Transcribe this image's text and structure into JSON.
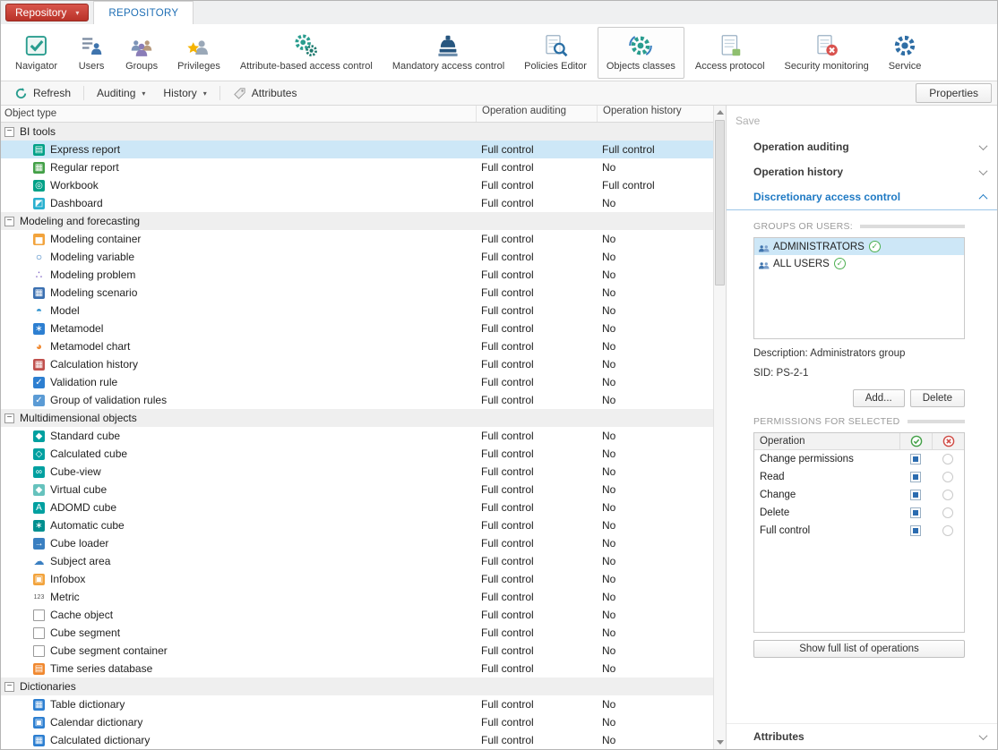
{
  "app": {
    "repository_button": "Repository",
    "tab": "REPOSITORY"
  },
  "colors": {
    "accent_blue": "#1f7ac4",
    "selection_blue": "#cde7f7",
    "repository_red": "#b93228",
    "check_green": "#43a047",
    "deny_red": "#cf4a44",
    "checkbox_blue": "#2b6cb0"
  },
  "ribbon": {
    "items": [
      {
        "label": "Navigator",
        "icon": "navigator-icon"
      },
      {
        "label": "Users",
        "icon": "users-icon"
      },
      {
        "label": "Groups",
        "icon": "groups-icon"
      },
      {
        "label": "Privileges",
        "icon": "privileges-icon"
      },
      {
        "label": "Attribute-based access control",
        "icon": "attribute-access-icon"
      },
      {
        "label": "Mandatory access control",
        "icon": "mandatory-access-icon"
      },
      {
        "label": "Policies Editor",
        "icon": "policies-editor-icon"
      },
      {
        "label": "Objects classes",
        "icon": "objects-classes-icon",
        "selected": true
      },
      {
        "label": "Access protocol",
        "icon": "access-protocol-icon"
      },
      {
        "label": "Security monitoring",
        "icon": "security-monitoring-icon"
      },
      {
        "label": "Service",
        "icon": "service-icon"
      }
    ]
  },
  "toolbar": {
    "refresh": "Refresh",
    "auditing": "Auditing",
    "history": "History",
    "attributes": "Attributes",
    "properties": "Properties"
  },
  "table": {
    "columns": [
      "Object type",
      "Operation auditing",
      "Operation history"
    ],
    "groups": [
      {
        "label": "BI tools",
        "rows": [
          {
            "label": "Express report",
            "icon": "express-report-icon",
            "bg": "#00a187",
            "glyph": "▤",
            "auditing": "Full control",
            "history": "Full control",
            "selected": true
          },
          {
            "label": "Regular report",
            "icon": "regular-report-icon",
            "bg": "#43a047",
            "glyph": "▦",
            "auditing": "Full control",
            "history": "No"
          },
          {
            "label": "Workbook",
            "icon": "workbook-icon",
            "bg": "#00a187",
            "glyph": "◎",
            "auditing": "Full control",
            "history": "Full control"
          },
          {
            "label": "Dashboard",
            "icon": "dashboard-icon",
            "bg": "#29b0cf",
            "glyph": "◩",
            "auditing": "Full control",
            "history": "No"
          }
        ]
      },
      {
        "label": "Modeling and forecasting",
        "rows": [
          {
            "label": "Modeling container",
            "icon": "modeling-container-icon",
            "bg": "#f2a33c",
            "glyph": "▅",
            "auditing": "Full control",
            "history": "No"
          },
          {
            "label": "Modeling variable",
            "icon": "modeling-variable-icon",
            "bg": "none",
            "fg": "#3a7fc1",
            "glyph": "○",
            "auditing": "Full control",
            "history": "No"
          },
          {
            "label": "Modeling problem",
            "icon": "modeling-problem-icon",
            "bg": "none",
            "fg": "#7a5cc3",
            "glyph": "∴",
            "auditing": "Full control",
            "history": "No"
          },
          {
            "label": "Modeling scenario",
            "icon": "modeling-scenario-icon",
            "bg": "#3a6fb0",
            "glyph": "▦",
            "auditing": "Full control",
            "history": "No"
          },
          {
            "label": "Model",
            "icon": "model-icon",
            "bg": "none",
            "fg": "#2f92cf",
            "glyph": "◓",
            "auditing": "Full control",
            "history": "No"
          },
          {
            "label": "Metamodel",
            "icon": "metamodel-icon",
            "bg": "#2d7fd1",
            "glyph": "∗",
            "auditing": "Full control",
            "history": "No"
          },
          {
            "label": "Metamodel chart",
            "icon": "metamodel-chart-icon",
            "bg": "none",
            "fg": "#f0882f",
            "glyph": "◕",
            "auditing": "Full control",
            "history": "No"
          },
          {
            "label": "Calculation history",
            "icon": "calculation-history-icon",
            "bg": "#c0504d",
            "glyph": "▦",
            "auditing": "Full control",
            "history": "No"
          },
          {
            "label": "Validation rule",
            "icon": "validation-rule-icon",
            "bg": "#2d7fd1",
            "glyph": "✓",
            "auditing": "Full control",
            "history": "No"
          },
          {
            "label": "Group of validation rules",
            "icon": "validation-rules-group-icon",
            "bg": "#5b9bd5",
            "glyph": "✓",
            "auditing": "Full control",
            "history": "No"
          }
        ]
      },
      {
        "label": "Multidimensional objects",
        "rows": [
          {
            "label": "Standard cube",
            "icon": "standard-cube-icon",
            "bg": "#00a0a0",
            "glyph": "◆",
            "auditing": "Full control",
            "history": "No"
          },
          {
            "label": "Calculated cube",
            "icon": "calculated-cube-icon",
            "bg": "#00a0a0",
            "glyph": "◇",
            "auditing": "Full control",
            "history": "No"
          },
          {
            "label": "Cube-view",
            "icon": "cube-view-icon",
            "bg": "#00a0a0",
            "glyph": "∞",
            "auditing": "Full control",
            "history": "No"
          },
          {
            "label": "Virtual cube",
            "icon": "virtual-cube-icon",
            "bg": "#66c2bd",
            "glyph": "◆",
            "auditing": "Full control",
            "history": "No"
          },
          {
            "label": "ADOMD cube",
            "icon": "adomd-cube-icon",
            "bg": "#00a0a0",
            "glyph": "A",
            "auditing": "Full control",
            "history": "No"
          },
          {
            "label": "Automatic cube",
            "icon": "automatic-cube-icon",
            "bg": "#008f8f",
            "glyph": "∗",
            "auditing": "Full control",
            "history": "No"
          },
          {
            "label": "Cube loader",
            "icon": "cube-loader-icon",
            "bg": "#3a7fc1",
            "glyph": "→",
            "auditing": "Full control",
            "history": "No"
          },
          {
            "label": "Subject area",
            "icon": "subject-area-icon",
            "bg": "none",
            "fg": "#3a7fc1",
            "glyph": "☁",
            "auditing": "Full control",
            "history": "No"
          },
          {
            "label": "Infobox",
            "icon": "infobox-icon",
            "bg": "#f2a33c",
            "glyph": "▣",
            "auditing": "Full control",
            "history": "No"
          },
          {
            "label": "Metric",
            "icon": "metric-icon",
            "bg": "none",
            "fg": "#555555",
            "glyph": "123",
            "auditing": "Full control",
            "history": "No"
          },
          {
            "label": "Cache object",
            "icon": "cache-object-icon",
            "bg": "#ffffff",
            "border": "#9a9a9a",
            "fg": "#9a9a9a",
            "glyph": "",
            "auditing": "Full control",
            "history": "No"
          },
          {
            "label": "Cube segment",
            "icon": "cube-segment-icon",
            "bg": "#ffffff",
            "border": "#9a9a9a",
            "fg": "#9a9a9a",
            "glyph": "",
            "auditing": "Full control",
            "history": "No"
          },
          {
            "label": "Cube segment container",
            "icon": "cube-segment-container-icon",
            "bg": "#ffffff",
            "border": "#9a9a9a",
            "fg": "#9a9a9a",
            "glyph": "",
            "auditing": "Full control",
            "history": "No"
          },
          {
            "label": "Time series database",
            "icon": "time-series-database-icon",
            "bg": "#f0882f",
            "glyph": "▤",
            "auditing": "Full control",
            "history": "No"
          }
        ]
      },
      {
        "label": "Dictionaries",
        "rows": [
          {
            "label": "Table dictionary",
            "icon": "table-dictionary-icon",
            "bg": "#2d7fd1",
            "glyph": "▦",
            "auditing": "Full control",
            "history": "No"
          },
          {
            "label": "Calendar dictionary",
            "icon": "calendar-dictionary-icon",
            "bg": "#2d7fd1",
            "glyph": "▣",
            "auditing": "Full control",
            "history": "No"
          },
          {
            "label": "Calculated dictionary",
            "icon": "calculated-dictionary-icon",
            "bg": "#2d7fd1",
            "glyph": "▦",
            "auditing": "Full control",
            "history": "No"
          }
        ]
      }
    ]
  },
  "panel": {
    "save_label": "Save",
    "sections": {
      "operation_auditing": "Operation auditing",
      "operation_history": "Operation history",
      "discretionary": "Discretionary access control",
      "attributes": "Attributes"
    },
    "groups_users_label": "GROUPS OR USERS:",
    "groups": [
      {
        "name": "ADMINISTRATORS",
        "selected": true
      },
      {
        "name": "ALL USERS"
      }
    ],
    "description": "Description: Administrators group",
    "sid": "SID: PS-2-1",
    "add_button": "Add...",
    "delete_button": "Delete",
    "permissions_label": "PERMISSIONS FOR SELECTED",
    "permissions_header": "Operation",
    "permissions": [
      {
        "operation": "Change permissions",
        "allow": true,
        "deny": false
      },
      {
        "operation": "Read",
        "allow": true,
        "deny": false
      },
      {
        "operation": "Change",
        "allow": true,
        "deny": false
      },
      {
        "operation": "Delete",
        "allow": true,
        "deny": false
      },
      {
        "operation": "Full control",
        "allow": true,
        "deny": false
      }
    ],
    "show_full_list_button": "Show full list of operations"
  }
}
